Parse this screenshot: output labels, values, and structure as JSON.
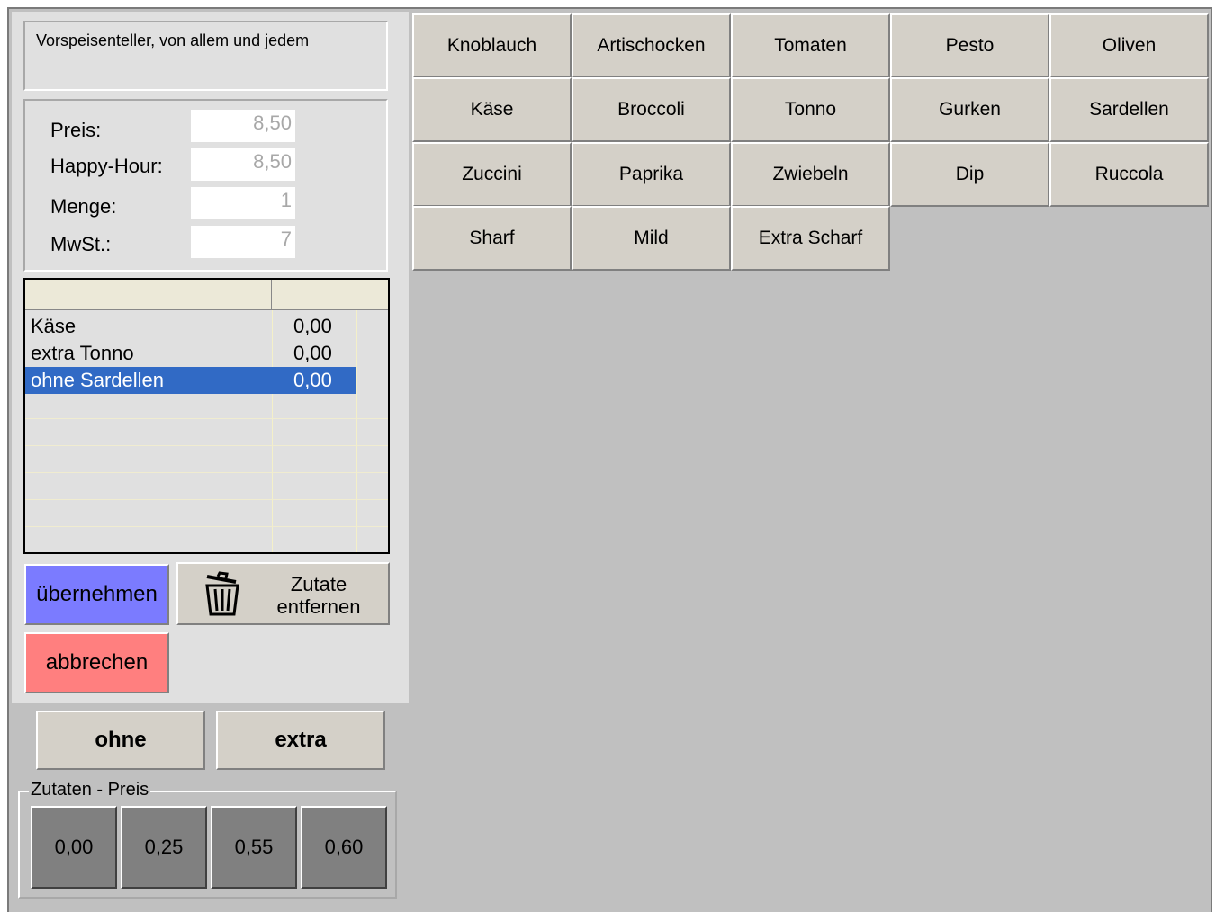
{
  "description": "Vorspeisenteller, von allem und jedem",
  "fields": [
    {
      "label": "Preis:",
      "value": "8,50"
    },
    {
      "label": "Happy-Hour:",
      "value": "8,50"
    },
    {
      "label": "Menge:",
      "value": "1"
    },
    {
      "label": "MwSt.:",
      "value": "7"
    }
  ],
  "extras_list": {
    "rows": [
      {
        "name": "Käse",
        "price": "0,00",
        "selected": false
      },
      {
        "name": "extra Tonno",
        "price": "0,00",
        "selected": false
      },
      {
        "name": "ohne Sardellen",
        "price": "0,00",
        "selected": true
      }
    ]
  },
  "actions": {
    "accept": "übernehmen",
    "remove": "Zutate entfernen",
    "cancel": "abbrechen",
    "accept_color": "#7b7bff",
    "cancel_color": "#ff7f7f",
    "remove_icon": "trash-icon"
  },
  "modifiers": {
    "ohne": "ohne",
    "extra": "extra"
  },
  "price_group": {
    "title": "Zutaten - Preis",
    "prices": [
      "0,00",
      "0,25",
      "0,55",
      "0,60"
    ]
  },
  "ingredients": [
    [
      "Knoblauch",
      "Artischocken",
      "Tomaten",
      "Pesto",
      "Oliven"
    ],
    [
      "Käse",
      "Broccoli",
      "Tonno",
      "Gurken",
      "Sardellen"
    ],
    [
      "Zuccini",
      "Paprika",
      "Zwiebeln",
      "Dip",
      "Ruccola"
    ],
    [
      "Sharf",
      "Mild",
      "Extra Scharf"
    ]
  ]
}
